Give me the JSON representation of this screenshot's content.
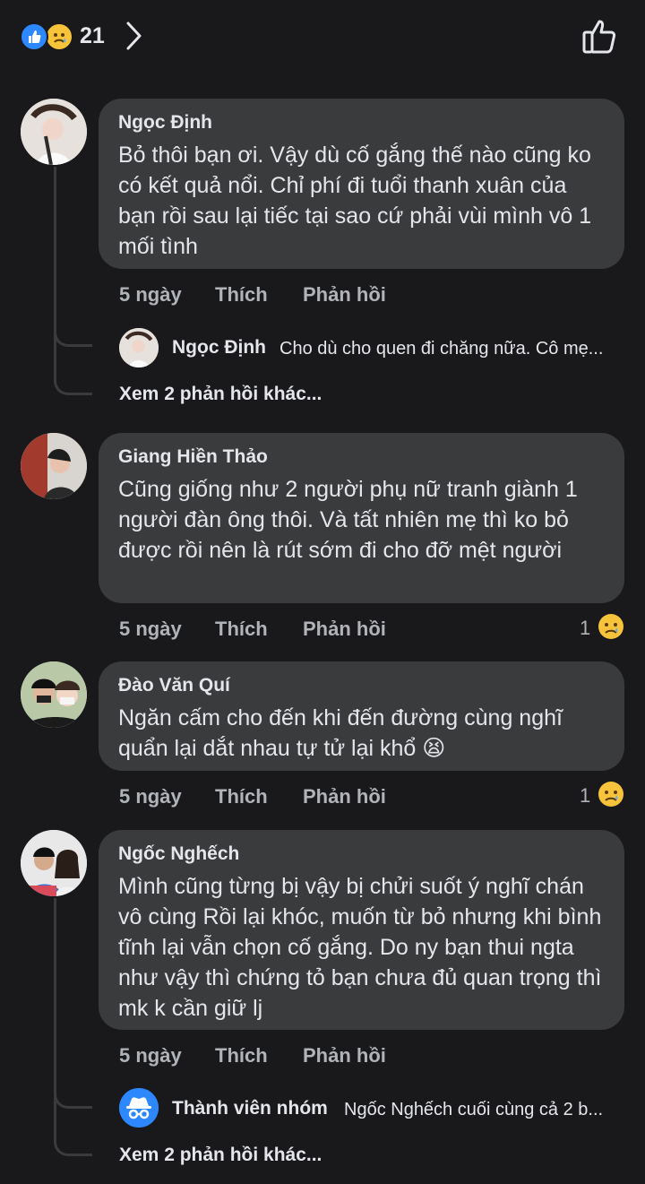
{
  "reactions": {
    "count": "21",
    "icons": [
      "like-icon",
      "sad-icon"
    ]
  },
  "comments": [
    {
      "author": "Ngọc Định",
      "text": "Bỏ thôi bạn ơi. Vậy dù cố gắng thế nào cũng ko có kết quả nổi. Chỉ phí đi tuổi thanh xuân của bạn rồi sau lại tiếc tại sao cứ phải vùi mình vô 1 mối tình",
      "time": "5 ngày",
      "like": "Thích",
      "reply": "Phản hồi",
      "reply_preview": {
        "author": "Ngọc Định",
        "text": "Cho dù cho quen đi chăng nữa. Cô mẹ..."
      },
      "more_replies": "Xem 2 phản hồi khác..."
    },
    {
      "author": "Giang Hiền Thảo",
      "text": "Cũng giống như 2 người phụ nữ tranh giành 1 người đàn ông thôi. Và tất nhiên mẹ thì ko bỏ được rồi nên là rút sớm đi cho đỡ mệt người",
      "time": "5 ngày",
      "like": "Thích",
      "reply": "Phản hồi",
      "reaction_count": "1",
      "reaction_icon": "sad-icon"
    },
    {
      "author": "Đào Văn Quí",
      "text": "Ngăn cấm cho đến khi đến đường cùng nghĩ quẩn lại dắt nhau tự tử lại khổ 😫",
      "time": "5 ngày",
      "like": "Thích",
      "reply": "Phản hồi",
      "reaction_count": "1",
      "reaction_icon": "sad-icon"
    },
    {
      "author": "Ngốc Nghếch",
      "text": "Mình cũng từng bị vậy bị chửi suốt ý nghĩ chán vô cùng Rồi lại khóc, muốn từ bỏ nhưng khi bình tĩnh lại  vẫn chọn cố gắng. Do ny bạn thui ngta như vậy thì chứng tỏ bạn chưa đủ quan trọng thì mk k cần giữ lj",
      "time": "5 ngày",
      "like": "Thích",
      "reply": "Phản hồi",
      "reply_preview": {
        "author": "Thành viên nhóm",
        "text": "Ngốc Nghếch cuối cùng cả 2 b..."
      },
      "more_replies": "Xem 2 phản hồi khác..."
    }
  ],
  "colors": {
    "background": "#19191b",
    "bubble": "#3a3b3c",
    "accent": "#2d88ff",
    "meta": "#b0b3b8"
  }
}
